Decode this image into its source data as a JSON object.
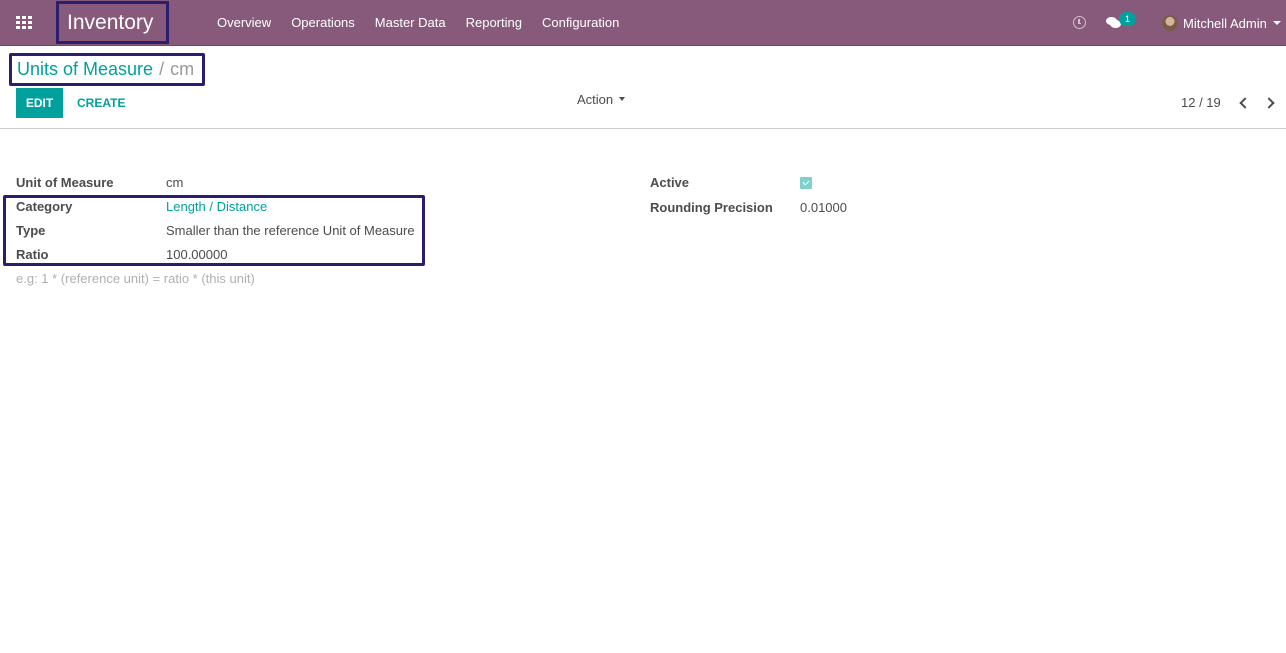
{
  "navbar": {
    "app_name": "Inventory",
    "menu": [
      "Overview",
      "Operations",
      "Master Data",
      "Reporting",
      "Configuration"
    ],
    "activity_icon": "clock-icon",
    "messages_icon": "chat-icon",
    "messages_count": "1",
    "user_name": "Mitchell Admin"
  },
  "control_panel": {
    "breadcrumb": {
      "parent": "Units of Measure",
      "separator": "/",
      "current": "cm"
    },
    "edit_label": "EDIT",
    "create_label": "CREATE",
    "action_label": "Action",
    "pager": {
      "value": "12 / 19",
      "current": 12,
      "total": 19
    }
  },
  "form": {
    "left": [
      {
        "label": "Unit of Measure",
        "value": "cm",
        "link": false
      },
      {
        "label": "Category",
        "value": "Length / Distance",
        "link": true
      },
      {
        "label": "Type",
        "value": "Smaller than the reference Unit of Measure",
        "link": false
      },
      {
        "label": "Ratio",
        "value": "100.00000",
        "link": false
      }
    ],
    "ratio_help": "e.g: 1 * (reference unit) = ratio * (this unit)",
    "right": {
      "active_label": "Active",
      "active_checked": true,
      "rounding_label": "Rounding Precision",
      "rounding_value": "0.01000"
    }
  },
  "colors": {
    "navbar": "#875a7b",
    "accent": "#00a09d",
    "highlight_border": "#2c1e6e"
  }
}
